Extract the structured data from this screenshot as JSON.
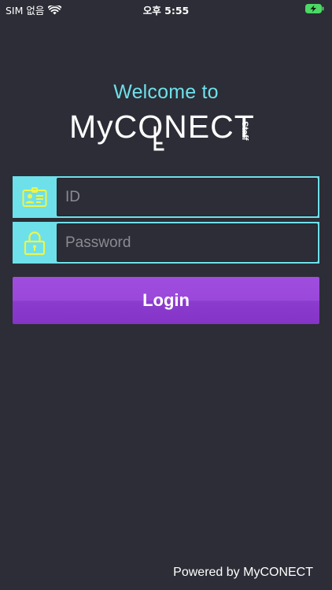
{
  "status_bar": {
    "carrier": "SIM 없음",
    "time": "오후 5:55",
    "icons": [
      "wifi-icon",
      "battery-charging-icon"
    ]
  },
  "header": {
    "welcome": "Welcome to",
    "logo_text": "MyCONECT",
    "logo_subtext": "Staff"
  },
  "form": {
    "id": {
      "icon": "id-card-icon",
      "placeholder": "ID",
      "value": ""
    },
    "password": {
      "icon": "lock-icon",
      "placeholder": "Password",
      "value": ""
    },
    "login_label": "Login"
  },
  "footer": {
    "powered_by": "Powered by MyCONECT"
  },
  "colors": {
    "background": "#2c2d36",
    "accent_cyan": "#6ee0ea",
    "icon_yellow": "#ecf54a",
    "button_purple": "#9a48da"
  }
}
